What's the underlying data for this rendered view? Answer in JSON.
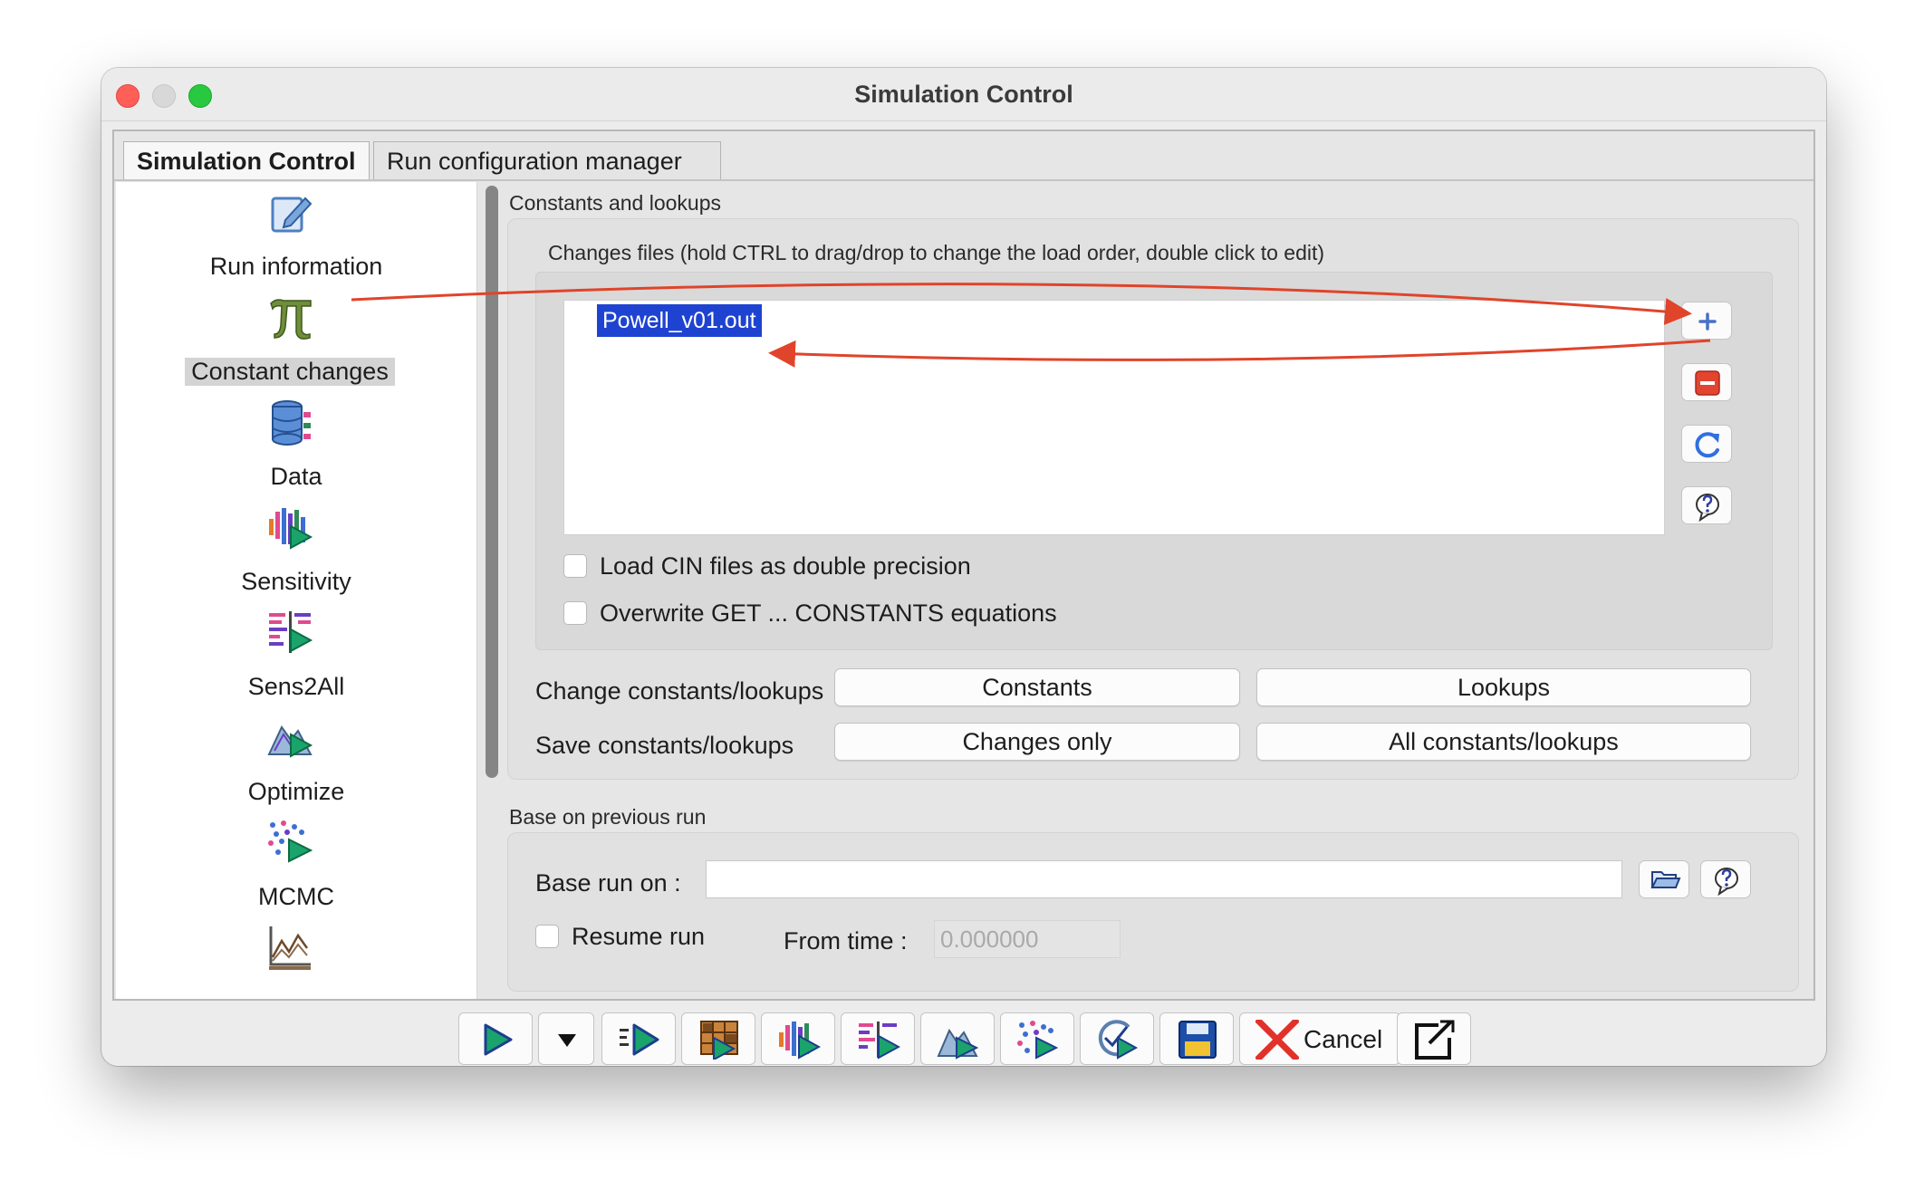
{
  "window": {
    "title": "Simulation Control"
  },
  "tabs": [
    {
      "label": "Simulation Control",
      "active": true
    },
    {
      "label": "Run configuration manager",
      "active": false
    }
  ],
  "sidebar": {
    "items": [
      {
        "label": "Run information",
        "icon": "edit-pencil-icon"
      },
      {
        "label": "Constant changes",
        "icon": "pi-icon",
        "selected": true
      },
      {
        "label": "Data",
        "icon": "database-icon"
      },
      {
        "label": "Sensitivity",
        "icon": "sensitivity-icon"
      },
      {
        "label": "Sens2All",
        "icon": "sens2all-icon"
      },
      {
        "label": "Optimize",
        "icon": "optimize-icon"
      },
      {
        "label": "MCMC",
        "icon": "mcmc-icon"
      },
      {
        "label": "",
        "icon": "chart-icon"
      }
    ]
  },
  "constants": {
    "group_title": "Constants and lookups",
    "changes_files_label": "Changes files (hold CTRL to drag/drop to change the load order, double click to edit)",
    "files": [
      "Powell_v01.out"
    ],
    "load_cin_label": "Load CIN files as double precision",
    "load_cin_checked": false,
    "overwrite_label": "Overwrite GET ... CONSTANTS equations",
    "overwrite_checked": false,
    "change_label": "Change constants/lookups",
    "constants_button": "Constants",
    "lookups_button": "Lookups",
    "save_label": "Save constants/lookups",
    "changes_only_button": "Changes only",
    "all_button": "All constants/lookups"
  },
  "base_run": {
    "group_title": "Base on previous run",
    "base_run_label": "Base run on :",
    "base_run_value": "",
    "resume_label": "Resume run",
    "resume_checked": false,
    "from_time_label": "From time :",
    "from_time_value": "0.000000"
  },
  "toolbar": {
    "buttons": [
      "run-icon",
      "dropdown-icon",
      "synthesim-icon",
      "data-run-icon",
      "sensitivity-run-icon",
      "sens2all-run-icon",
      "optimize-run-icon",
      "mcmc-run-icon",
      "check-run-icon",
      "save-icon",
      "cancel-icon",
      "exit-icon"
    ],
    "cancel_label": "Cancel"
  },
  "colors": {
    "accent": "#1f43d1",
    "annotation_arrow": "#e0442a",
    "remove_button": "#e2442f",
    "play": "#1aa36b"
  }
}
